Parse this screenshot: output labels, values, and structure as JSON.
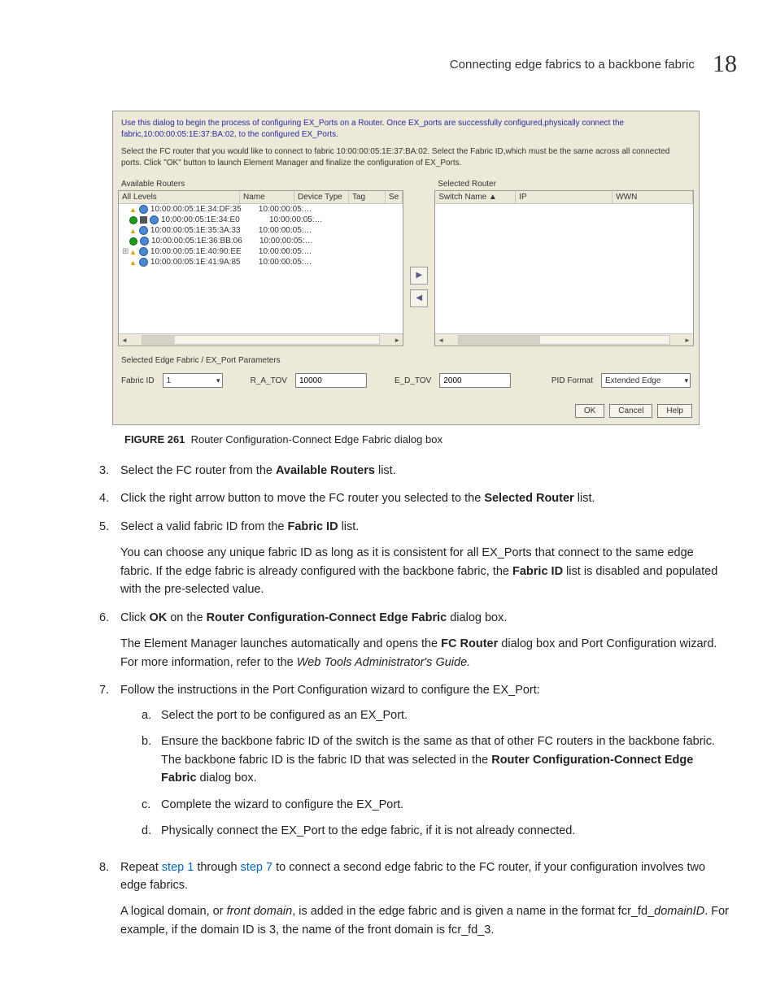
{
  "header": {
    "title": "Connecting edge fabrics to a backbone fabric",
    "chapter": "18"
  },
  "shot": {
    "intro": "Use this dialog to begin the process of configuring EX_Ports on a Router. Once EX_ports are successfully configured,physically connect the fabric,10:00:00:05:1E:37:BA:02, to the configured EX_Ports.",
    "intro2": "Select the FC router that you would like to connect to fabric 10:00:00:05:1E:37:BA:02. Select the Fabric ID,which must be the same across all connected ports. Click \"OK\" button to launch Element Manager and finalize the configuration of EX_Ports.",
    "left_title": "Available Routers",
    "left_cols": [
      "All Levels",
      "Name",
      "Device Type",
      "Tag",
      "Se"
    ],
    "routers": [
      {
        "tree": "",
        "status": "warn",
        "wwn": "10:00:00:05:1E:34:DF:35",
        "name": "10:00:00:05:…"
      },
      {
        "tree": "",
        "status": "ok",
        "wwn": "10:00:00:05:1E:34:E0",
        "name": "10:00:00:05:…",
        "special": true
      },
      {
        "tree": "",
        "status": "warn",
        "wwn": "10:00:00:05:1E:35:3A:33",
        "name": "10:00:00:05:…"
      },
      {
        "tree": "",
        "status": "ok",
        "wwn": "10:00:00:05:1E:36:BB:06",
        "name": "10:00:00:05:…"
      },
      {
        "tree": "⊞",
        "status": "warn",
        "wwn": "10:00:00:05:1E:40:90:EE",
        "name": "10:00:00:05:…"
      },
      {
        "tree": "",
        "status": "warn",
        "wwn": "10:00:00:05:1E:41:9A:85",
        "name": "10:00:00:05:…"
      }
    ],
    "right_title": "Selected Router",
    "right_cols": [
      "Switch Name ▲",
      "IP",
      "WWN"
    ],
    "params_label": "Selected Edge Fabric / EX_Port Parameters",
    "params": {
      "fabric_id_label": "Fabric ID",
      "fabric_id_value": "1",
      "ratov_label": "R_A_TOV",
      "ratov_value": "10000",
      "edtov_label": "E_D_TOV",
      "edtov_value": "2000",
      "pid_label": "PID Format",
      "pid_value": "Extended Edge"
    },
    "buttons": {
      "ok": "OK",
      "cancel": "Cancel",
      "help": "Help"
    }
  },
  "caption": {
    "label": "FIGURE 261",
    "text": "Router Configuration-Connect Edge Fabric dialog box"
  },
  "steps": {
    "s3_a": "Select the FC router from the ",
    "s3_b": "Available Routers",
    "s3_c": " list.",
    "s4_a": "Click the right arrow button to move the FC router you selected to the ",
    "s4_b": "Selected Router",
    "s4_c": " list.",
    "s5_a": "Select a valid fabric ID from the ",
    "s5_b": "Fabric ID",
    "s5_c": " list.",
    "s5p_a": "You can choose any unique fabric ID as long as it is consistent for all EX_Ports that connect to the same edge fabric. If the edge fabric is already configured with the backbone fabric, the ",
    "s5p_b": "Fabric ID",
    "s5p_c": " list is disabled and populated with the pre-selected value.",
    "s6_a": "Click ",
    "s6_b": "OK",
    "s6_c": " on the ",
    "s6_d": "Router Configuration-Connect Edge Fabric",
    "s6_e": " dialog box.",
    "s6p_a": "The Element Manager launches automatically and opens the ",
    "s6p_b": "FC Router",
    "s6p_c": " dialog box and Port Configuration wizard. For more information, refer to the ",
    "s6p_d": "Web Tools Administrator's Guide.",
    "s7": "Follow the instructions in the Port Configuration wizard to configure the EX_Port:",
    "s7a": "Select the port to be configured as an EX_Port.",
    "s7b_a": "Ensure the backbone fabric ID of the switch is the same as that of other FC routers in the backbone fabric. The backbone fabric ID is the fabric ID that was selected in the ",
    "s7b_b": "Router Configuration-Connect Edge Fabric",
    "s7b_c": " dialog box.",
    "s7c": "Complete the wizard to configure the EX_Port.",
    "s7d": "Physically connect the EX_Port to the edge fabric, if it is not already connected.",
    "s8_a": "Repeat ",
    "s8_b": "step 1",
    "s8_c": " through ",
    "s8_d": "step 7",
    "s8_e": " to connect a second edge fabric to the FC router, if your configuration involves two edge fabrics.",
    "s8p_a": "A logical domain, or ",
    "s8p_b": "front domain",
    "s8p_c": ", is added in the edge fabric and is given a name in the format fcr_fd_",
    "s8p_d": "domainID",
    "s8p_e": ". For example, if the domain ID is 3, the name of the front domain is fcr_fd_3."
  },
  "nums": {
    "n3": "3.",
    "n4": "4.",
    "n5": "5.",
    "n6": "6.",
    "n7": "7.",
    "n8": "8.",
    "a": "a.",
    "b": "b.",
    "c": "c.",
    "d": "d."
  }
}
